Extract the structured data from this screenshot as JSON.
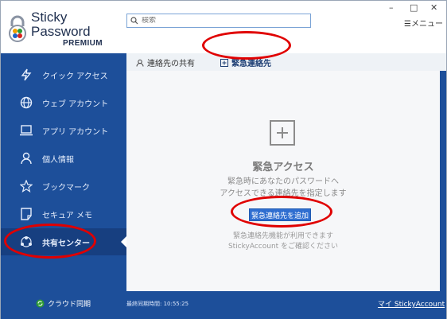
{
  "app": {
    "logo_line1": "Sticky",
    "logo_line2": "Password",
    "logo_line3": "PREMIUM"
  },
  "search": {
    "placeholder": "検索"
  },
  "window_controls": {
    "minimize": "–",
    "maximize": "□",
    "close": "✕"
  },
  "menu": {
    "label": "☰メニュー"
  },
  "sidebar": {
    "items": [
      {
        "label": "クイック アクセス",
        "icon": "lightning-icon"
      },
      {
        "label": "ウェブ アカウント",
        "icon": "globe-icon"
      },
      {
        "label": "アプリ アカウント",
        "icon": "laptop-icon"
      },
      {
        "label": "個人情報",
        "icon": "person-icon"
      },
      {
        "label": "ブックマーク",
        "icon": "star-icon"
      },
      {
        "label": "セキュア メモ",
        "icon": "note-icon"
      },
      {
        "label": "共有センター",
        "icon": "share-icon",
        "active": true
      }
    ],
    "cloud_sync": "クラウド同期"
  },
  "tabs": [
    {
      "label": "連絡先の共有",
      "icon": "contacts-icon"
    },
    {
      "label": "緊急連絡先",
      "icon": "plus-square-icon",
      "active": true
    }
  ],
  "emergency": {
    "title": "緊急アクセス",
    "desc_line1": "緊急時にあなたのパスワードへ",
    "desc_line2": "アクセスできる連絡先を指定します",
    "add_button": "緊急連絡先を追加",
    "note_line1": "緊急連絡先機能が利用できます",
    "note_line2": "StickyAccount をご確認ください"
  },
  "footer": {
    "last_sync": "最終同期時間: 10:55:25",
    "account_link": "マイ StickyAccount"
  },
  "colors": {
    "sidebar": "#1d4f9a",
    "accent_button": "#2f6ed0",
    "highlight": "#e00000"
  }
}
